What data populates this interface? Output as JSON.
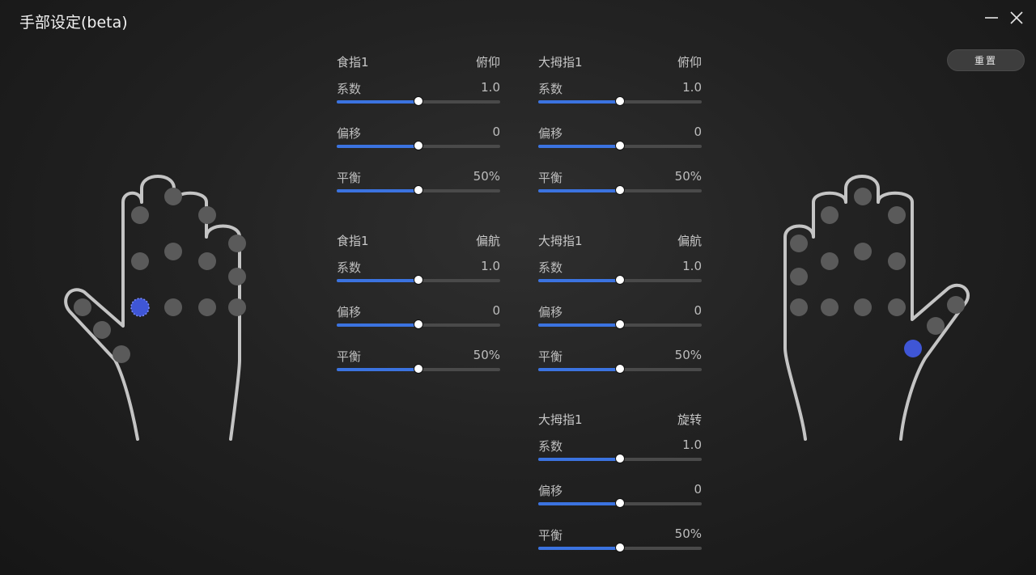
{
  "window": {
    "title": "手部设定(beta)"
  },
  "toolbar": {
    "reset_label": "重置"
  },
  "colors": {
    "accent": "#3b73e0",
    "track": "#4a4a4a",
    "active_joint": "#3f56d6"
  },
  "groups": [
    {
      "finger": "食指1",
      "axis": "俯仰",
      "params": [
        {
          "label": "系数",
          "value": "1.0",
          "level": 0.5
        },
        {
          "label": "偏移",
          "value": "0",
          "level": 0.5
        },
        {
          "label": "平衡",
          "value": "50%",
          "level": 0.5
        }
      ]
    },
    {
      "finger": "大拇指1",
      "axis": "俯仰",
      "params": [
        {
          "label": "系数",
          "value": "1.0",
          "level": 0.5
        },
        {
          "label": "偏移",
          "value": "0",
          "level": 0.5
        },
        {
          "label": "平衡",
          "value": "50%",
          "level": 0.5
        }
      ]
    },
    {
      "finger": "食指1",
      "axis": "偏航",
      "params": [
        {
          "label": "系数",
          "value": "1.0",
          "level": 0.5
        },
        {
          "label": "偏移",
          "value": "0",
          "level": 0.5
        },
        {
          "label": "平衡",
          "value": "50%",
          "level": 0.5
        }
      ]
    },
    {
      "finger": "大拇指1",
      "axis": "偏航",
      "params": [
        {
          "label": "系数",
          "value": "1.0",
          "level": 0.5
        },
        {
          "label": "偏移",
          "value": "0",
          "level": 0.5
        },
        {
          "label": "平衡",
          "value": "50%",
          "level": 0.5
        }
      ]
    },
    {
      "finger": "大拇指1",
      "axis": "旋转",
      "params": [
        {
          "label": "系数",
          "value": "1.0",
          "level": 0.5
        },
        {
          "label": "偏移",
          "value": "0",
          "level": 0.5
        },
        {
          "label": "平衡",
          "value": "50%",
          "level": 0.5
        }
      ]
    }
  ]
}
